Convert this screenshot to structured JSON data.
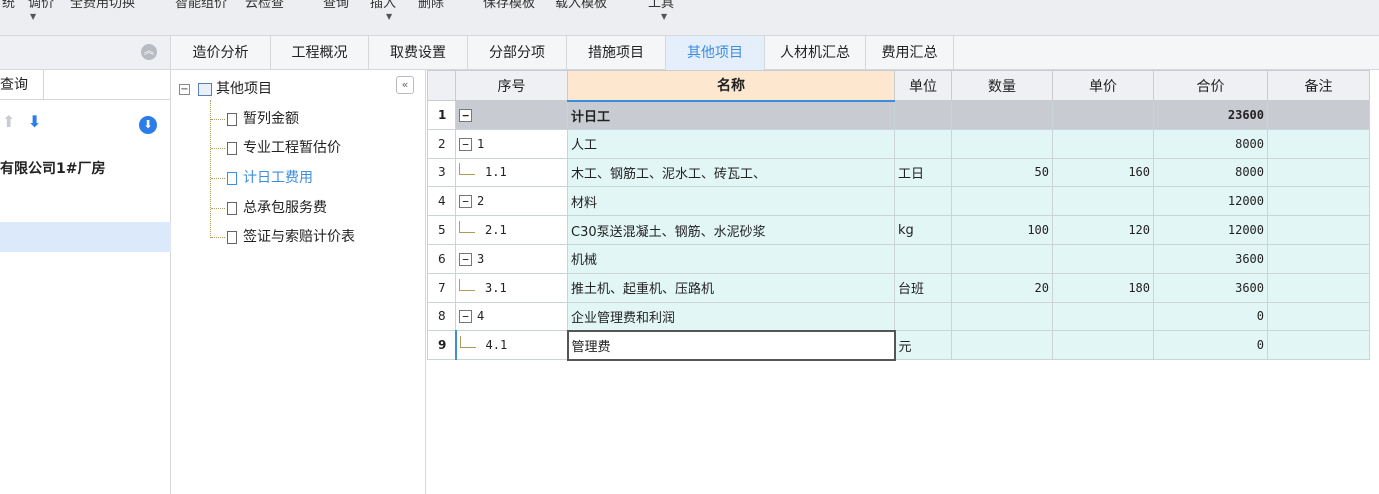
{
  "toolbar": {
    "items": [
      "统",
      "调价",
      "全费用切换",
      "智能组价",
      "云检查",
      "查询",
      "插入",
      "删除",
      "保存模板",
      "载入模板",
      "工具"
    ]
  },
  "left_panel": {
    "search_tab": "查询",
    "project_name": "有限公司1#厂房"
  },
  "tabs": [
    {
      "label": "造价分析"
    },
    {
      "label": "工程概况"
    },
    {
      "label": "取费设置"
    },
    {
      "label": "分部分项"
    },
    {
      "label": "措施项目"
    },
    {
      "label": "其他项目"
    },
    {
      "label": "人材机汇总"
    },
    {
      "label": "费用汇总"
    }
  ],
  "active_tab": "其他项目",
  "tree": {
    "root": "其他项目",
    "children": [
      "暂列金额",
      "专业工程暂估价",
      "计日工费用",
      "总承包服务费",
      "签证与索赔计价表"
    ],
    "active": "计日工费用"
  },
  "grid": {
    "columns": [
      "序号",
      "名称",
      "单位",
      "数量",
      "单价",
      "合价",
      "备注"
    ],
    "rows": [
      {
        "n": "1",
        "seq": "",
        "name": "计日工",
        "unit": "",
        "qty": "",
        "price": "",
        "total": "23600",
        "note": ""
      },
      {
        "n": "2",
        "seq": "1",
        "name": "人工",
        "unit": "",
        "qty": "",
        "price": "",
        "total": "8000",
        "note": ""
      },
      {
        "n": "3",
        "seq": "1.1",
        "name": "木工、钢筋工、泥水工、砖瓦工、",
        "unit": "工日",
        "qty": "50",
        "price": "160",
        "total": "8000",
        "note": ""
      },
      {
        "n": "4",
        "seq": "2",
        "name": "材料",
        "unit": "",
        "qty": "",
        "price": "",
        "total": "12000",
        "note": ""
      },
      {
        "n": "5",
        "seq": "2.1",
        "name": "C30泵送混凝土、钢筋、水泥砂浆",
        "unit": "kg",
        "qty": "100",
        "price": "120",
        "total": "12000",
        "note": ""
      },
      {
        "n": "6",
        "seq": "3",
        "name": "机械",
        "unit": "",
        "qty": "",
        "price": "",
        "total": "3600",
        "note": ""
      },
      {
        "n": "7",
        "seq": "3.1",
        "name": "推土机、起重机、压路机",
        "unit": "台班",
        "qty": "20",
        "price": "180",
        "total": "3600",
        "note": ""
      },
      {
        "n": "8",
        "seq": "4",
        "name": "企业管理费和利润",
        "unit": "",
        "qty": "",
        "price": "",
        "total": "0",
        "note": ""
      },
      {
        "n": "9",
        "seq": "4.1",
        "name": "管理费",
        "unit": "元",
        "qty": "",
        "price": "",
        "total": "0",
        "note": ""
      }
    ]
  }
}
